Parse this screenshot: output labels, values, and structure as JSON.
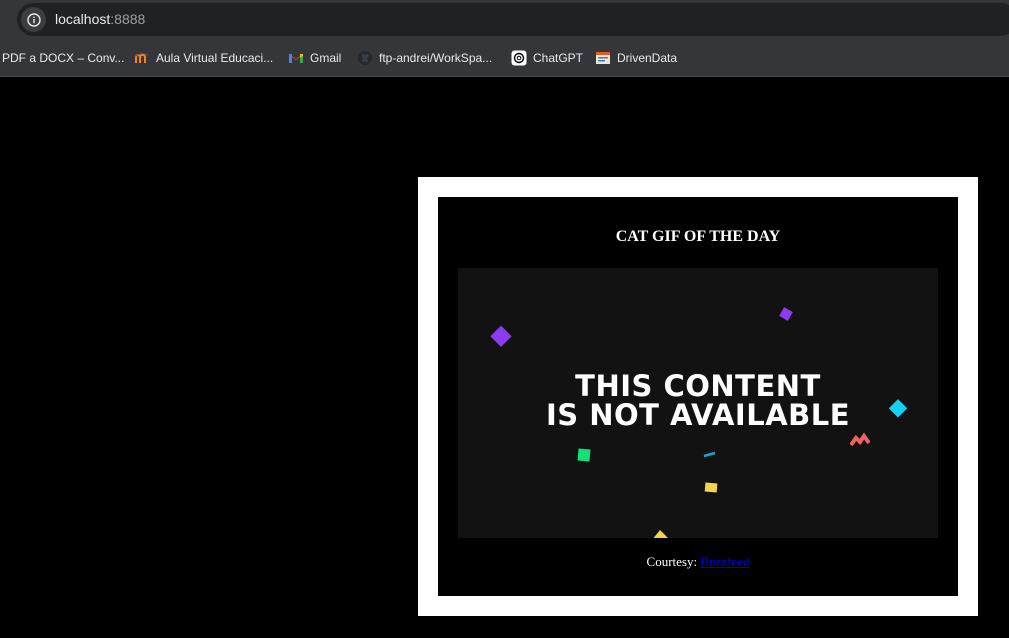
{
  "browser": {
    "url_host": "localhost",
    "url_port": ":8888",
    "bookmarks": [
      {
        "label": "PDF a DOCX – Conv...",
        "icon": "pdf-icon"
      },
      {
        "label": "Aula Virtual Educaci...",
        "icon": "moodle-icon"
      },
      {
        "label": "Gmail",
        "icon": "gmail-icon"
      },
      {
        "label": "ftp-andrei/WorkSpa...",
        "icon": "github-icon"
      },
      {
        "label": "ChatGPT",
        "icon": "chatgpt-icon"
      },
      {
        "label": "DrivenData",
        "icon": "drivendata-icon"
      }
    ]
  },
  "card": {
    "title": "CAT GIF OF THE DAY",
    "gif_line1": "THIS CONTENT",
    "gif_line2": "IS NOT AVAILABLE",
    "courtesy_label": "Courtesy:",
    "courtesy_link": "Buzzfeed"
  },
  "colors": {
    "page_bg": "#000000",
    "card_border": "#ffffff",
    "gif_bg": "#121212",
    "link": "#0000ee",
    "confetti": [
      "#8b3cf0",
      "#13d1f5",
      "#14e07a",
      "#f5d547",
      "#f06262"
    ]
  }
}
